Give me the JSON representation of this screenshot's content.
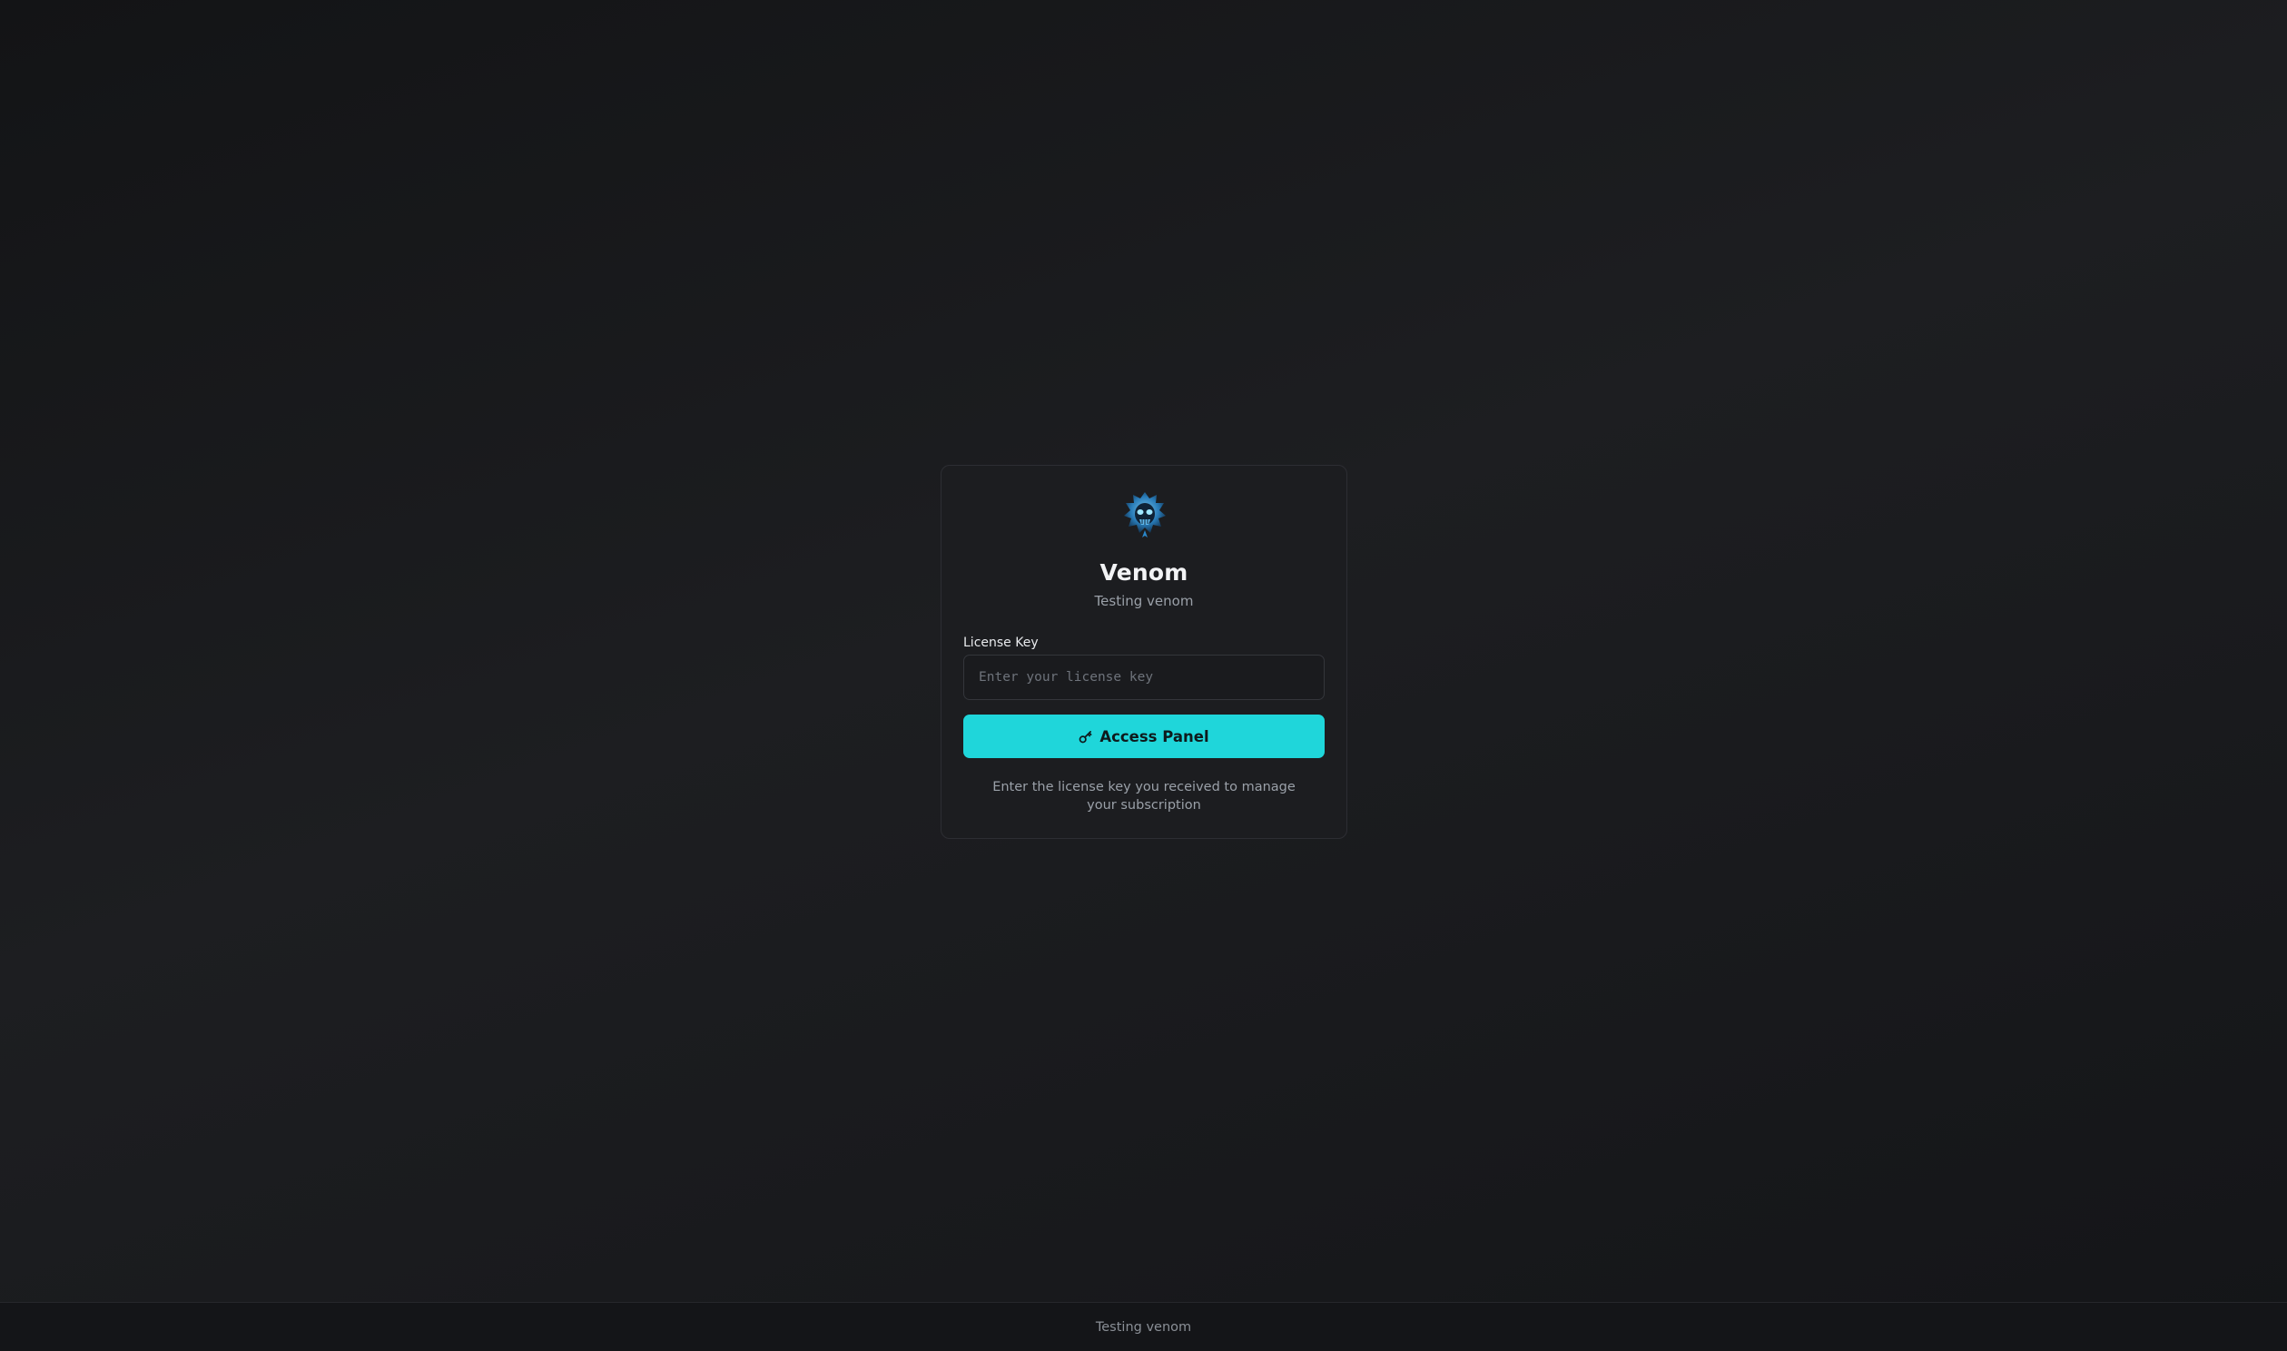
{
  "brand": {
    "name": "Venom",
    "tagline": "Testing venom",
    "logo_icon": "venom-skull-logo",
    "accent_color": "#1fd6da"
  },
  "form": {
    "license_label": "License Key",
    "license_value": "",
    "license_placeholder": "Enter your license key",
    "submit_label": "Access Panel",
    "submit_icon": "key-icon",
    "hint": "Enter the license key you received to manage your subscription"
  },
  "footer": {
    "text": "Testing venom"
  }
}
